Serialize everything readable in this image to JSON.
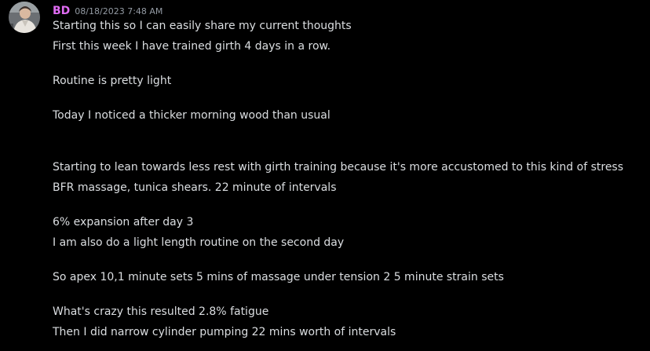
{
  "message": {
    "author": "BD",
    "timestamp": "08/18/2023 7:48 AM",
    "author_color": "#e06cf3",
    "lines": [
      "Starting this so I can easily share my current thoughts",
      "First this week I have trained girth 4 days in a row.",
      "Routine is pretty light",
      "Today I noticed a thicker morning wood than usual",
      "Starting to lean towards less rest with girth training because it's more accustomed to this kind of stress",
      "BFR massage, tunica shears. 22 minute of intervals",
      "6% expansion after day 3",
      "I am also do a light length routine on the second day",
      "So apex 10,1 minute sets 5 mins of massage under tension 2 5 minute strain sets",
      "What's crazy this resulted 2.8% fatigue",
      "Then I did narrow cylinder pumping 22 mins worth of intervals"
    ]
  }
}
